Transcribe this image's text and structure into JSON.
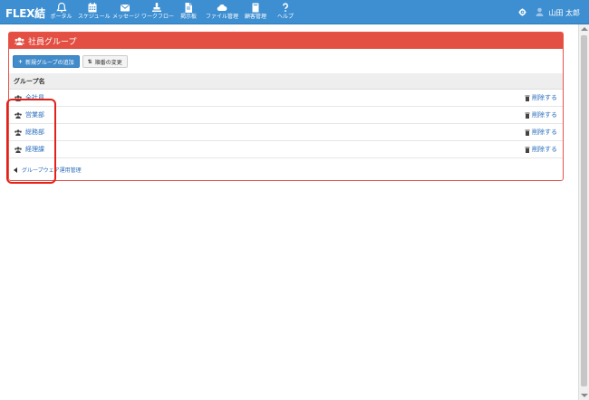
{
  "app": {
    "logo": "FLEX結"
  },
  "nav": [
    {
      "id": "portal",
      "label": "ポータル",
      "icon": "bell-icon"
    },
    {
      "id": "schedule",
      "label": "スケジュール",
      "icon": "calendar-icon"
    },
    {
      "id": "message",
      "label": "メッセージ",
      "icon": "envelope-icon"
    },
    {
      "id": "workflow",
      "label": "ワークフロー",
      "icon": "stamp-icon"
    },
    {
      "id": "board",
      "label": "掲示板",
      "icon": "document-icon"
    },
    {
      "id": "files",
      "label": "ファイル管理",
      "icon": "cloud-icon"
    },
    {
      "id": "office",
      "label": "顧客管理",
      "icon": "book-icon"
    },
    {
      "id": "help",
      "label": "ヘルプ",
      "icon": "question-icon"
    }
  ],
  "user": {
    "name": "山田 太郎"
  },
  "panel": {
    "title": "社員グループ"
  },
  "toolbar": {
    "add_label": "新規グループの追加",
    "order_label": "順番の変更"
  },
  "table": {
    "header": "グループ名",
    "rows": [
      {
        "name": "全社員",
        "action": "削除する"
      },
      {
        "name": "営業部",
        "action": "削除する"
      },
      {
        "name": "総務部",
        "action": "削除する"
      },
      {
        "name": "経理課",
        "action": "削除する"
      }
    ]
  },
  "back_link": "グループウェア運用管理",
  "colors": {
    "navbar": "#3d8fd1",
    "panel_header": "#e34f42",
    "link": "#2a6ebb",
    "primary_button": "#428bca",
    "highlight": "#e32119"
  }
}
